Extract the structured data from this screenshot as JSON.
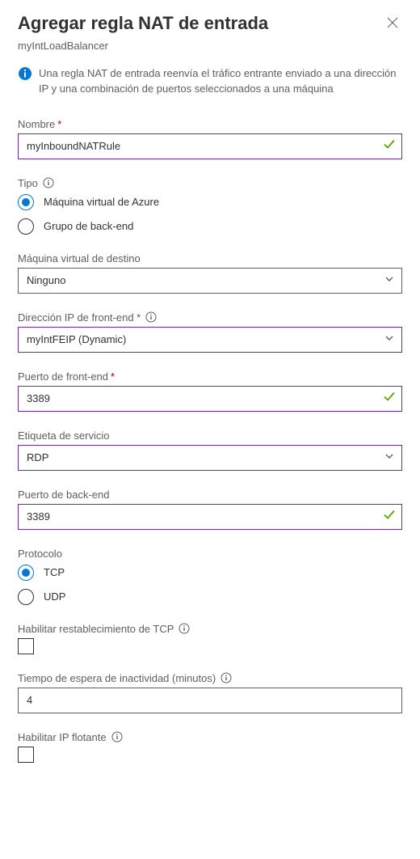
{
  "header": {
    "title": "Agregar regla NAT de entrada",
    "subtitle": "myIntLoadBalancer"
  },
  "banner": {
    "text": "Una regla NAT de entrada reenvía el tráfico entrante enviado a una dirección IP y una combinación de puertos seleccionados a una máquina"
  },
  "fields": {
    "name": {
      "label": "Nombre",
      "value": "myInboundNATRule"
    },
    "type": {
      "label": "Tipo",
      "options": {
        "azurevm": "Máquina virtual de Azure",
        "backendgroup": "Grupo de back-end"
      }
    },
    "destvm": {
      "label": "Máquina virtual de destino",
      "value": "Ninguno"
    },
    "frontendip": {
      "label": "Dirección IP de front-end *",
      "value": "myIntFEIP (Dynamic)"
    },
    "frontendport": {
      "label": "Puerto de front-end",
      "value": "3389"
    },
    "servicetag": {
      "label": "Etiqueta de servicio",
      "value": "RDP"
    },
    "backendport": {
      "label": "Puerto de back-end",
      "value": "3389"
    },
    "protocol": {
      "label": "Protocolo",
      "options": {
        "tcp": "TCP",
        "udp": "UDP"
      }
    },
    "tcpreset": {
      "label": "Habilitar restablecimiento de TCP"
    },
    "idletimeout": {
      "label": "Tiempo de espera de inactividad (minutos)",
      "value": "4"
    },
    "floatingip": {
      "label": "Habilitar IP flotante"
    }
  },
  "colors": {
    "primary": "#0078d4",
    "accent": "#6b2e91",
    "success": "#57a300",
    "danger": "#a80000"
  }
}
